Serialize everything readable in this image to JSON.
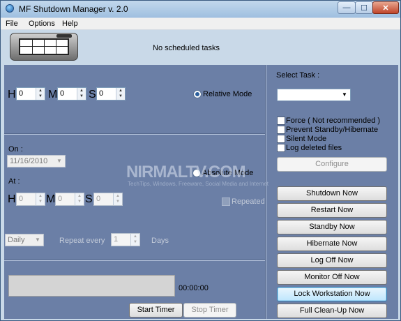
{
  "window": {
    "title": "MF Shutdown Manager v. 2.0",
    "min_glyph": "—",
    "max_glyph": "☐",
    "close_glyph": "✕"
  },
  "menu": [
    "File",
    "Options",
    "Help"
  ],
  "header": {
    "status": "No scheduled tasks"
  },
  "relative": {
    "h_label": "H",
    "m_label": "M",
    "s_label": "S",
    "h_value": "0",
    "m_value": "0",
    "s_value": "0",
    "mode_label": "Relative Mode",
    "mode_selected": true
  },
  "absolute": {
    "on_label": "On :",
    "date_value": "11/16/2010",
    "mode_label": "Absolute Mode",
    "at_label": "At :",
    "h_label": "H",
    "m_label": "M",
    "s_label": "S",
    "h_value": "0",
    "m_value": "0",
    "s_value": "0",
    "repeated_label": "Repeated",
    "repeat_combo_value": "Daily",
    "repeat_every_label": "Repeat every",
    "repeat_every_value": "1",
    "days_label": "Days"
  },
  "timer": {
    "time": "00:00:00",
    "start_label": "Start Timer",
    "stop_label": "Stop Timer"
  },
  "task": {
    "select_label": "Select Task :",
    "select_value": "",
    "options": [
      "Force ( Not recommended )",
      "Prevent Standby/Hibernate",
      "Silent Mode",
      "Log deleted files"
    ],
    "configure_label": "Configure"
  },
  "actions": [
    "Shutdown Now",
    "Restart Now",
    "Standby Now",
    "Hibernate Now",
    "Log Off Now",
    "Monitor Off Now",
    "Lock Workstation Now",
    "Full Clean-Up Now"
  ],
  "watermark": {
    "main": "NIRMALTV.COM",
    "sub": "TechTips, Windows, Freeware, Social Media and Internet"
  },
  "icons": {
    "app": "app-globe-icon",
    "logo": "shutdown-manager-logo-icon"
  }
}
